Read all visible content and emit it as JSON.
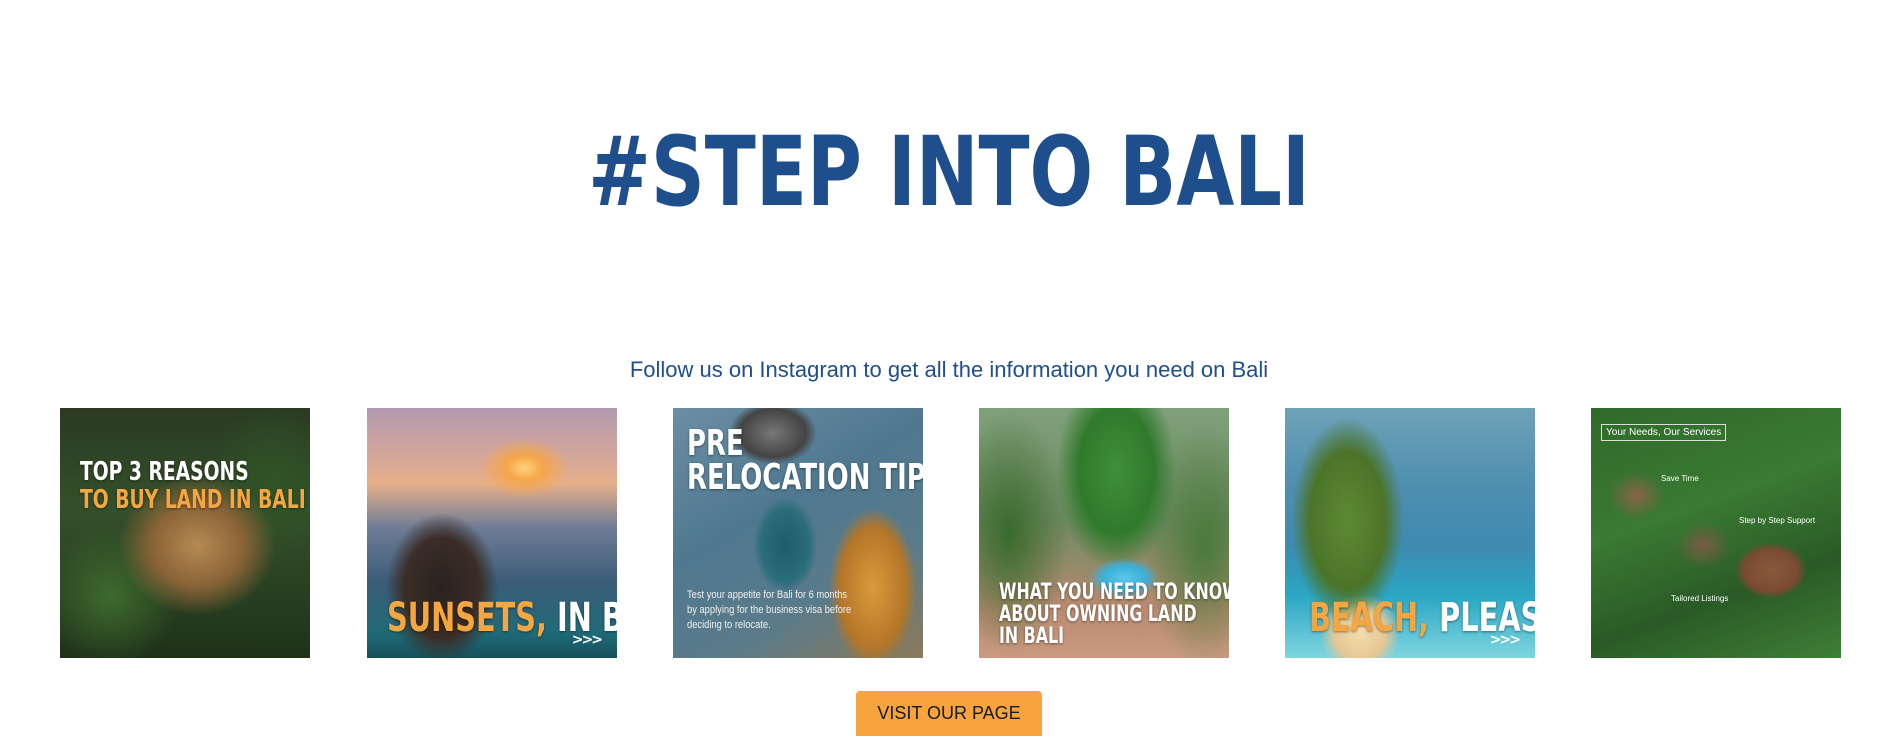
{
  "headline": "#STEP INTO BALI",
  "subline": "Follow us on Instagram to get all the information you need on Bali",
  "posts": [
    {
      "line1": "TOP 3 REASONS",
      "line2": "TO BUY LAND IN BALI"
    },
    {
      "accent": "SUNSETS,",
      "rest": "IN BALI.",
      "arrows": ">>>"
    },
    {
      "line1": "PRE",
      "line2": "RELOCATION TIP",
      "body_line1": "Test your appetite for Bali for 6 months",
      "body_line2": "by applying for the business visa before",
      "body_line3": "deciding to relocate."
    },
    {
      "line1": "WHAT YOU NEED TO KNOW",
      "line2": "ABOUT OWNING LAND",
      "line3": "IN BALI"
    },
    {
      "accent": "BEACH,",
      "rest": "PLEASE.",
      "arrows": ">>>"
    },
    {
      "tag": "Your Needs, Our Services",
      "label1": "Save Time",
      "label2": "Step by Step Support",
      "label3": "Tailored Listings"
    }
  ],
  "cta": {
    "label": "VISIT OUR PAGE"
  },
  "colors": {
    "brand_blue": "#1f4e8c",
    "accent_orange": "#f7a43e"
  }
}
